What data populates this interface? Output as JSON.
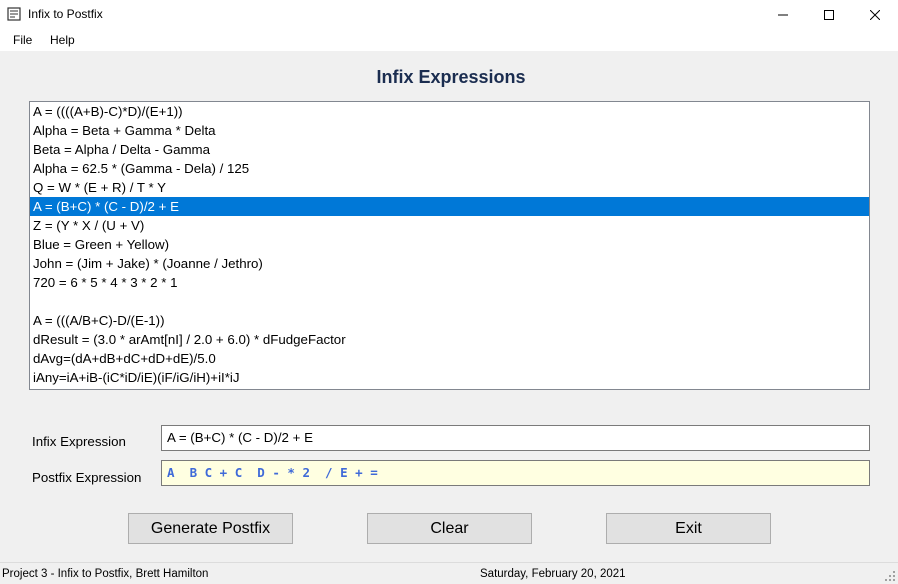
{
  "window": {
    "title": "Infix to Postfix",
    "icon": "app-window-icon",
    "controls": [
      "minimize-icon",
      "maximize-icon",
      "close-icon"
    ]
  },
  "menu": {
    "file": "File",
    "help": "Help"
  },
  "heading": "Infix Expressions",
  "expressions": [
    "A = ((((A+B)-C)*D)/(E+1))",
    "Alpha = Beta + Gamma * Delta",
    "Beta = Alpha / Delta - Gamma",
    "Alpha = 62.5 * (Gamma - Dela) / 125",
    "Q = W * (E + R) / T * Y",
    "A = (B+C) * (C - D)/2 + E",
    "Z = (Y * X / (U + V)",
    "Blue = Green + Yellow)",
    "John = (Jim + Jake) * (Joanne / Jethro)",
    "720 = 6 * 5 * 4 * 3 * 2 * 1",
    "",
    "A = (((A/B+C)-D/(E-1))",
    "dResult = (3.0 * arAmt[nI] / 2.0 + 6.0) * dFudgeFactor",
    "dAvg=(dA+dB+dC+dD+dE)/5.0",
    "iAny=iA+iB-(iC*iD/iE)(iF/iG/iH)+iI*iJ"
  ],
  "selected_index": 5,
  "form": {
    "infix_label": "Infix Expression",
    "infix_value": "A = (B+C) * (C - D)/2 + E",
    "postfix_label": "Postfix Expression",
    "postfix_value": "A  B C + C  D - * 2  / E + ="
  },
  "buttons": {
    "generate": "Generate Postfix",
    "clear": "Clear",
    "exit": "Exit"
  },
  "status": {
    "left": "Project 3 - Infix to Postfix, Brett Hamilton",
    "date": "Saturday, February 20, 2021"
  },
  "colors": {
    "selection": "#0078d7",
    "heading": "#1b2d50",
    "postfix_text": "#3f6ad8",
    "postfix_bg": "#ffffe1"
  }
}
